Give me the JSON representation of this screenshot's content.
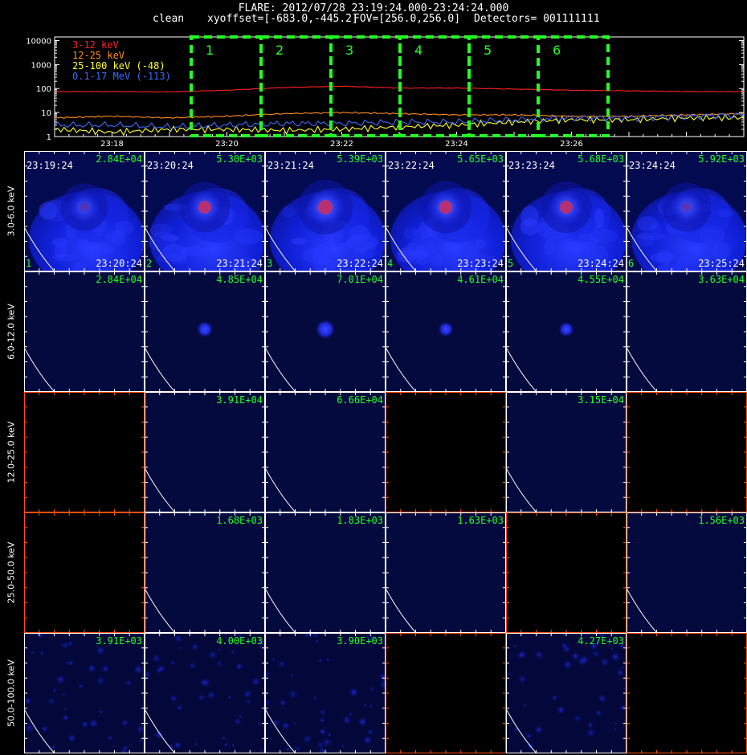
{
  "header": {
    "title": "FLARE: 2012/07/28 23:19:24.000-23:24:24.000",
    "method": "clean",
    "xyoffset": "xyoffset=[-683.0,-445.2]",
    "fov": "FOV=[256.0,256.0]",
    "detectors": "Detectors= 001111111"
  },
  "lightcurve": {
    "legend": [
      {
        "label": "3-12 keV",
        "color": "#ff2020"
      },
      {
        "label": "12-25 keV",
        "color": "#ff8c1a"
      },
      {
        "label": "25-100 keV (-48)",
        "color": "#ffff33"
      },
      {
        "label": "0.1-17 MeV (-113)",
        "color": "#3a6bff"
      }
    ],
    "y_ticks": [
      "10000",
      "1000",
      "100",
      "10",
      "1"
    ],
    "x_ticks": [
      "23:18",
      "23:20",
      "23:22",
      "23:24",
      "23:26"
    ],
    "intervals": [
      "1",
      "2",
      "3",
      "4",
      "5",
      "6"
    ],
    "interval_color": "#22ff22"
  },
  "chart_data": {
    "type": "line",
    "title": "FLARE: 2012/07/28 23:19:24.000-23:24:24.000",
    "x_range_minutes": [
      "23:17",
      "23:29"
    ],
    "ylim": [
      1,
      10000
    ],
    "y_scale": "log",
    "series": [
      {
        "name": "3-12 keV",
        "x": [
          "23:17",
          "23:18",
          "23:19",
          "23:20",
          "23:21",
          "23:22",
          "23:23",
          "23:24",
          "23:25",
          "23:26",
          "23:27",
          "23:28",
          "23:29"
        ],
        "values": [
          75,
          75,
          72,
          85,
          110,
          125,
          105,
          105,
          95,
          85,
          80,
          75,
          75
        ]
      },
      {
        "name": "12-25 keV",
        "x": [
          "23:17",
          "23:18",
          "23:19",
          "23:20",
          "23:21",
          "23:22",
          "23:23",
          "23:24",
          "23:25",
          "23:26",
          "23:27",
          "23:28",
          "23:29"
        ],
        "values": [
          6,
          7,
          6,
          7,
          9,
          10,
          9,
          8,
          8,
          7,
          7,
          8,
          9
        ]
      },
      {
        "name": "25-100 keV (-48)",
        "x": [
          "23:17",
          "23:18",
          "23:19",
          "23:20",
          "23:21",
          "23:22",
          "23:23",
          "23:24",
          "23:25",
          "23:26",
          "23:27",
          "23:28",
          "23:29"
        ],
        "values": [
          2,
          1.5,
          2,
          2,
          1.8,
          2,
          2.5,
          3,
          4,
          5,
          5,
          6,
          6
        ]
      },
      {
        "name": "0.1-17 MeV (-113)",
        "x": [
          "23:17",
          "23:18",
          "23:19",
          "23:20",
          "23:21",
          "23:22",
          "23:23",
          "23:24",
          "23:25",
          "23:26",
          "23:27",
          "23:28",
          "23:29"
        ],
        "values": [
          3,
          3,
          2.5,
          3,
          3.5,
          3.5,
          4,
          4,
          5,
          6,
          6,
          7,
          8
        ]
      }
    ]
  },
  "image_grid": {
    "row_labels": [
      "3.0-6.0 keV",
      "6.0-12.0 keV",
      "12.0-25.0 keV",
      "25.0-50.0 keV",
      "50.0-100.0 keV"
    ],
    "colors": {
      "text_green": "#22ff22",
      "axis_white": "#ffffff",
      "axis_orange": "#ff5010",
      "map_blue": "#0a14a0"
    },
    "rows": [
      [
        {
          "max": "2.84E+04",
          "tstart": "23:19:24",
          "tend": "23:20:24",
          "index": "1",
          "state": "map",
          "source": 0.55,
          "bright": 0.25
        },
        {
          "max": "5.30E+03",
          "tstart": "23:20:24",
          "tend": "23:21:24",
          "index": "2",
          "state": "map",
          "source": 0.75,
          "bright": 0.5
        },
        {
          "max": "5.39E+03",
          "tstart": "23:21:24",
          "tend": "23:22:24",
          "index": "3",
          "state": "map",
          "source": 1.0,
          "bright": 0.7
        },
        {
          "max": "5.65E+03",
          "tstart": "23:22:24",
          "tend": "23:23:24",
          "index": "4",
          "state": "map",
          "source": 0.85,
          "bright": 0.55
        },
        {
          "max": "5.68E+03",
          "tstart": "23:23:24",
          "tend": "23:24:24",
          "index": "5",
          "state": "map",
          "source": 0.8,
          "bright": 0.5
        },
        {
          "max": "5.92E+03",
          "tstart": "23:24:24",
          "tend": "23:25:24",
          "index": "6",
          "state": "map",
          "source": 0.65,
          "bright": 0.4
        }
      ],
      [
        {
          "max": "2.84E+04",
          "state": "dim",
          "source": 0
        },
        {
          "max": "4.85E+04",
          "state": "dim",
          "source": 0.35
        },
        {
          "max": "7.01E+04",
          "state": "dim",
          "source": 0.55
        },
        {
          "max": "4.61E+04",
          "state": "dim",
          "source": 0.3
        },
        {
          "max": "4.55E+04",
          "state": "dim",
          "source": 0.3
        },
        {
          "max": "3.63E+04",
          "state": "dim",
          "source": 0
        }
      ],
      [
        {
          "max": "",
          "state": "empty"
        },
        {
          "max": "3.91E+04",
          "state": "dim",
          "source": 0
        },
        {
          "max": "6.66E+04",
          "state": "dim",
          "source": 0
        },
        {
          "max": "",
          "state": "empty"
        },
        {
          "max": "3.15E+04",
          "state": "dim",
          "source": 0
        },
        {
          "max": "",
          "state": "empty"
        }
      ],
      [
        {
          "max": "",
          "state": "empty"
        },
        {
          "max": "1.68E+03",
          "state": "dim",
          "source": 0
        },
        {
          "max": "1.83E+03",
          "state": "dim",
          "source": 0
        },
        {
          "max": "1.63E+03",
          "state": "dim",
          "source": 0
        },
        {
          "max": "",
          "state": "empty"
        },
        {
          "max": "1.56E+03",
          "state": "dim",
          "source": 0
        }
      ],
      [
        {
          "max": "3.91E+03",
          "state": "noise",
          "source": 0
        },
        {
          "max": "4.00E+03",
          "state": "noise",
          "source": 0
        },
        {
          "max": "3.90E+03",
          "state": "noise",
          "source": 0
        },
        {
          "max": "",
          "state": "empty"
        },
        {
          "max": "4.27E+03",
          "state": "noise",
          "source": 0
        },
        {
          "max": "",
          "state": "empty"
        }
      ]
    ]
  }
}
